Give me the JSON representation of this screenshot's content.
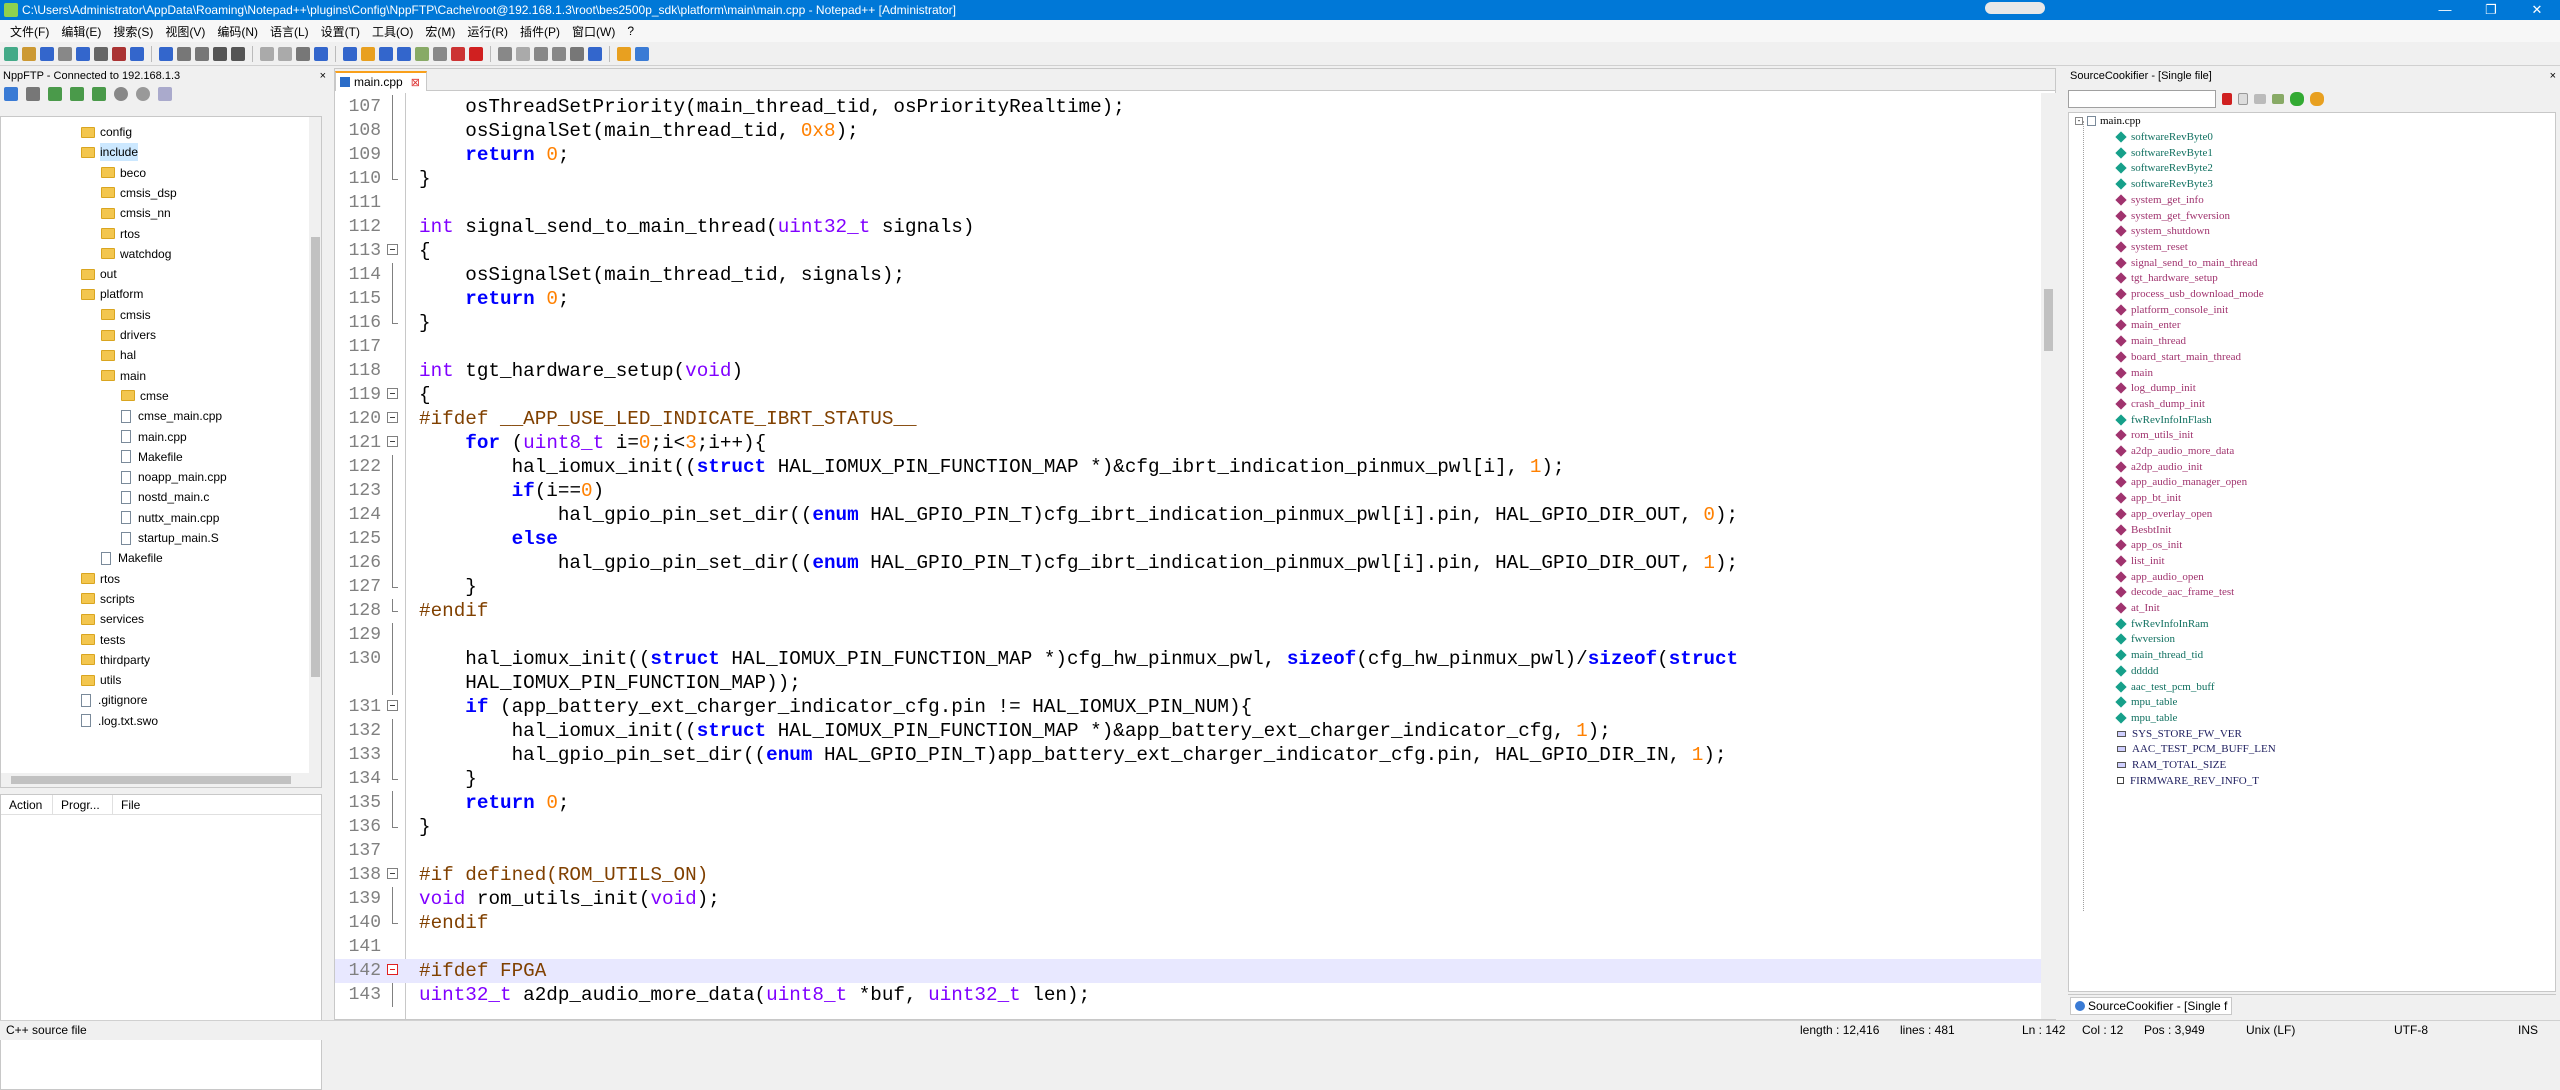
{
  "window": {
    "title": "C:\\Users\\Administrator\\AppData\\Roaming\\Notepad++\\plugins\\Config\\NppFTP\\Cache\\root@192.168.1.3\\root\\bes2500p_sdk\\platform\\main\\main.cpp - Notepad++ [Administrator]",
    "controls": [
      "—",
      "❐",
      "✕"
    ]
  },
  "menu": [
    "文件(F)",
    "编辑(E)",
    "搜索(S)",
    "视图(V)",
    "编码(N)",
    "语言(L)",
    "设置(T)",
    "工具(O)",
    "宏(M)",
    "运行(R)",
    "插件(P)",
    "窗口(W)",
    "?"
  ],
  "ftp": {
    "title": "NppFTP - Connected to 192.168.1.3",
    "close": "×",
    "tree": [
      {
        "label": "config",
        "type": "folder",
        "depth": 1
      },
      {
        "label": "include",
        "type": "folder",
        "depth": 1,
        "selected": true
      },
      {
        "label": "beco",
        "type": "folder",
        "depth": 2
      },
      {
        "label": "cmsis_dsp",
        "type": "folder",
        "depth": 2
      },
      {
        "label": "cmsis_nn",
        "type": "folder",
        "depth": 2
      },
      {
        "label": "rtos",
        "type": "folder",
        "depth": 2
      },
      {
        "label": "watchdog",
        "type": "folder",
        "depth": 2
      },
      {
        "label": "out",
        "type": "folder",
        "depth": 1
      },
      {
        "label": "platform",
        "type": "folder",
        "depth": 1
      },
      {
        "label": "cmsis",
        "type": "folder",
        "depth": 2
      },
      {
        "label": "drivers",
        "type": "folder",
        "depth": 2
      },
      {
        "label": "hal",
        "type": "folder",
        "depth": 2
      },
      {
        "label": "main",
        "type": "folder",
        "depth": 2
      },
      {
        "label": "cmse",
        "type": "folder",
        "depth": 3
      },
      {
        "label": "cmse_main.cpp",
        "type": "file",
        "depth": 3
      },
      {
        "label": "main.cpp",
        "type": "file",
        "depth": 3
      },
      {
        "label": "Makefile",
        "type": "file",
        "depth": 3
      },
      {
        "label": "noapp_main.cpp",
        "type": "file",
        "depth": 3
      },
      {
        "label": "nostd_main.c",
        "type": "file",
        "depth": 3
      },
      {
        "label": "nuttx_main.cpp",
        "type": "file",
        "depth": 3
      },
      {
        "label": "startup_main.S",
        "type": "file",
        "depth": 3
      },
      {
        "label": "Makefile",
        "type": "file",
        "depth": 2
      },
      {
        "label": "rtos",
        "type": "folder",
        "depth": 1
      },
      {
        "label": "scripts",
        "type": "folder",
        "depth": 1
      },
      {
        "label": "services",
        "type": "folder",
        "depth": 1
      },
      {
        "label": "tests",
        "type": "folder",
        "depth": 1
      },
      {
        "label": "thirdparty",
        "type": "folder",
        "depth": 1
      },
      {
        "label": "utils",
        "type": "folder",
        "depth": 1
      },
      {
        "label": ".gitignore",
        "type": "file",
        "depth": 1
      },
      {
        "label": ".log.txt.swo",
        "type": "file",
        "depth": 1
      }
    ],
    "queue_headers": [
      "Action",
      "Progr...",
      "File"
    ]
  },
  "editor": {
    "tab": {
      "label": "main.cpp",
      "close": "⊠"
    },
    "lines": [
      {
        "n": "107",
        "html": "    osThreadSetPriority(main_thread_tid, osPriorityRealtime);",
        "fold": "line"
      },
      {
        "n": "108",
        "html": "    osSignalSet(main_thread_tid, <span class=\"num\">0x8</span>);",
        "fold": "line"
      },
      {
        "n": "109",
        "html": "    <span class=\"kw\">return</span> <span class=\"num\">0</span>;",
        "fold": "line"
      },
      {
        "n": "110",
        "html": "}",
        "fold": "end"
      },
      {
        "n": "111",
        "html": "",
        "fold": ""
      },
      {
        "n": "112",
        "html": "<span class=\"ty\">int</span> signal_send_to_main_thread(<span class=\"ty\">uint32_t</span> signals)",
        "fold": ""
      },
      {
        "n": "113",
        "html": "{",
        "fold": "box"
      },
      {
        "n": "114",
        "html": "    osSignalSet(main_thread_tid, signals);",
        "fold": "line"
      },
      {
        "n": "115",
        "html": "    <span class=\"kw\">return</span> <span class=\"num\">0</span>;",
        "fold": "line"
      },
      {
        "n": "116",
        "html": "}",
        "fold": "end"
      },
      {
        "n": "117",
        "html": "",
        "fold": ""
      },
      {
        "n": "118",
        "html": "<span class=\"ty\">int</span> tgt_hardware_setup(<span class=\"ty\">void</span>)",
        "fold": ""
      },
      {
        "n": "119",
        "html": "{",
        "fold": "box"
      },
      {
        "n": "120",
        "html": "<span class=\"pp\">#ifdef __APP_USE_LED_INDICATE_IBRT_STATUS__</span>",
        "fold": "box"
      },
      {
        "n": "121",
        "html": "    <span class=\"kw\">for</span> (<span class=\"ty\">uint8_t</span> i=<span class=\"num\">0</span>;i&lt;<span class=\"num\">3</span>;i++){",
        "fold": "box"
      },
      {
        "n": "122",
        "html": "        hal_iomux_init((<span class=\"kw\">struct</span> HAL_IOMUX_PIN_FUNCTION_MAP *)&amp;cfg_ibrt_indication_pinmux_pwl[i], <span class=\"num\">1</span>);",
        "fold": "line"
      },
      {
        "n": "123",
        "html": "        <span class=\"kw\">if</span>(i==<span class=\"num\">0</span>)",
        "fold": "line"
      },
      {
        "n": "124",
        "html": "            hal_gpio_pin_set_dir((<span class=\"kw\">enum</span> HAL_GPIO_PIN_T)cfg_ibrt_indication_pinmux_pwl[i].pin, HAL_GPIO_DIR_OUT, <span class=\"num\">0</span>);",
        "fold": "line"
      },
      {
        "n": "125",
        "html": "        <span class=\"kw\">else</span>",
        "fold": "line"
      },
      {
        "n": "126",
        "html": "            hal_gpio_pin_set_dir((<span class=\"kw\">enum</span> HAL_GPIO_PIN_T)cfg_ibrt_indication_pinmux_pwl[i].pin, HAL_GPIO_DIR_OUT, <span class=\"num\">1</span>);",
        "fold": "line"
      },
      {
        "n": "127",
        "html": "    }",
        "fold": "end"
      },
      {
        "n": "128",
        "html": "<span class=\"pp\">#endif</span>",
        "fold": "end"
      },
      {
        "n": "129",
        "html": "",
        "fold": "line"
      },
      {
        "n": "130",
        "html": "    hal_iomux_init((<span class=\"kw\">struct</span> HAL_IOMUX_PIN_FUNCTION_MAP *)cfg_hw_pinmux_pwl, <span class=\"kw\">sizeof</span>(cfg_hw_pinmux_pwl)/<span class=\"kw\">sizeof</span>(<span class=\"kw\">struct</span>",
        "fold": "line"
      },
      {
        "n": "",
        "html": "    HAL_IOMUX_PIN_FUNCTION_MAP));",
        "fold": "line"
      },
      {
        "n": "131",
        "html": "    <span class=\"kw\">if</span> (app_battery_ext_charger_indicator_cfg.pin != HAL_IOMUX_PIN_NUM){",
        "fold": "box"
      },
      {
        "n": "132",
        "html": "        hal_iomux_init((<span class=\"kw\">struct</span> HAL_IOMUX_PIN_FUNCTION_MAP *)&amp;app_battery_ext_charger_indicator_cfg, <span class=\"num\">1</span>);",
        "fold": "line"
      },
      {
        "n": "133",
        "html": "        hal_gpio_pin_set_dir((<span class=\"kw\">enum</span> HAL_GPIO_PIN_T)app_battery_ext_charger_indicator_cfg.pin, HAL_GPIO_DIR_IN, <span class=\"num\">1</span>);",
        "fold": "line"
      },
      {
        "n": "134",
        "html": "    }",
        "fold": "end"
      },
      {
        "n": "135",
        "html": "    <span class=\"kw\">return</span> <span class=\"num\">0</span>;",
        "fold": "line"
      },
      {
        "n": "136",
        "html": "}",
        "fold": "end"
      },
      {
        "n": "137",
        "html": "",
        "fold": ""
      },
      {
        "n": "138",
        "html": "<span class=\"pp\">#if defined(ROM_UTILS_ON)</span>",
        "fold": "box"
      },
      {
        "n": "139",
        "html": "<span class=\"ty\">void</span> rom_utils_init(<span class=\"ty\">void</span>);",
        "fold": "line"
      },
      {
        "n": "140",
        "html": "<span class=\"pp\">#endif</span>",
        "fold": "end"
      },
      {
        "n": "141",
        "html": "",
        "fold": ""
      },
      {
        "n": "142",
        "html": "<span class=\"pp\">#ifdef FPGA</span>",
        "fold": "boxred",
        "current": true
      },
      {
        "n": "143",
        "html": "<span class=\"ty\">uint32_t</span> a2dp_audio_more_data(<span class=\"ty\">uint8_t</span> *buf, <span class=\"ty\">uint32_t</span> len);",
        "fold": "line"
      }
    ]
  },
  "sourcecookifier": {
    "title": "SourceCookifier - [Single file]",
    "close": "×",
    "root": "main.cpp",
    "symbols": [
      {
        "label": "softwareRevByte0",
        "kind": "var"
      },
      {
        "label": "softwareRevByte1",
        "kind": "var"
      },
      {
        "label": "softwareRevByte2",
        "kind": "var"
      },
      {
        "label": "softwareRevByte3",
        "kind": "var"
      },
      {
        "label": "system_get_info",
        "kind": "func"
      },
      {
        "label": "system_get_fwversion",
        "kind": "func"
      },
      {
        "label": "system_shutdown",
        "kind": "func"
      },
      {
        "label": "system_reset",
        "kind": "func"
      },
      {
        "label": "signal_send_to_main_thread",
        "kind": "func"
      },
      {
        "label": "tgt_hardware_setup",
        "kind": "func"
      },
      {
        "label": "process_usb_download_mode",
        "kind": "func"
      },
      {
        "label": "platform_console_init",
        "kind": "func"
      },
      {
        "label": "main_enter",
        "kind": "func"
      },
      {
        "label": "main_thread",
        "kind": "func"
      },
      {
        "label": "board_start_main_thread",
        "kind": "func"
      },
      {
        "label": "main",
        "kind": "func"
      },
      {
        "label": "log_dump_init",
        "kind": "func"
      },
      {
        "label": "crash_dump_init",
        "kind": "func"
      },
      {
        "label": "fwRevInfoInFlash",
        "kind": "var"
      },
      {
        "label": "rom_utils_init",
        "kind": "func"
      },
      {
        "label": "a2dp_audio_more_data",
        "kind": "func"
      },
      {
        "label": "a2dp_audio_init",
        "kind": "func"
      },
      {
        "label": "app_audio_manager_open",
        "kind": "func"
      },
      {
        "label": "app_bt_init",
        "kind": "func"
      },
      {
        "label": "app_overlay_open",
        "kind": "func"
      },
      {
        "label": "BesbtInit",
        "kind": "func"
      },
      {
        "label": "app_os_init",
        "kind": "func"
      },
      {
        "label": "list_init",
        "kind": "func"
      },
      {
        "label": "app_audio_open",
        "kind": "func"
      },
      {
        "label": "decode_aac_frame_test",
        "kind": "func"
      },
      {
        "label": "at_Init",
        "kind": "func"
      },
      {
        "label": "fwRevInfoInRam",
        "kind": "var"
      },
      {
        "label": "fwversion",
        "kind": "var"
      },
      {
        "label": "main_thread_tid",
        "kind": "var"
      },
      {
        "label": "ddddd",
        "kind": "var"
      },
      {
        "label": "aac_test_pcm_buff",
        "kind": "var"
      },
      {
        "label": "mpu_table",
        "kind": "var"
      },
      {
        "label": "mpu_table",
        "kind": "var"
      },
      {
        "label": "SYS_STORE_FW_VER",
        "kind": "mac"
      },
      {
        "label": "AAC_TEST_PCM_BUFF_LEN",
        "kind": "mac"
      },
      {
        "label": "RAM_TOTAL_SIZE",
        "kind": "mac"
      },
      {
        "label": "FIRMWARE_REV_INFO_T",
        "kind": "struct"
      }
    ],
    "bottom_tab": "SourceCookifier - [Single f"
  },
  "status": {
    "filetype": "C++ source file",
    "length": "length : 12,416",
    "lines": "lines : 481",
    "ln": "Ln : 142",
    "col": "Col : 12",
    "pos": "Pos : 3,949",
    "eol": "Unix (LF)",
    "encoding": "UTF-8",
    "mode": "INS"
  }
}
